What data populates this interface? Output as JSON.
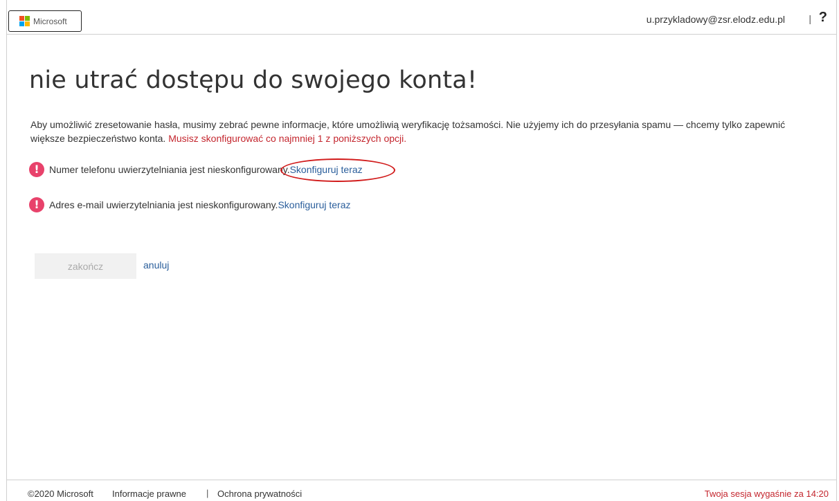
{
  "header": {
    "logo_text": "Microsoft",
    "logo_colors": [
      "#f25022",
      "#7fba00",
      "#00a4ef",
      "#ffb900"
    ],
    "user_email": "u.przykladowy@zsr.elodz.edu.pl",
    "separator": "|",
    "help_label": "?"
  },
  "main": {
    "title": "nie utrać dostępu do swojego konta!",
    "intro_text": "Aby umożliwić zresetowanie hasła, musimy zebrać pewne informacje, które umożliwią weryfikację tożsamości. Nie użyjemy ich do przesyłania spamu — chcemy tylko zapewnić większe bezpieczeństwo konta. ",
    "intro_required": "Musisz skonfigurować co najmniej 1 z poniższych opcji.",
    "items": [
      {
        "text": "Numer telefonu uwierzytelniania jest nieskonfigurowany. ",
        "link": "Skonfiguruj teraz"
      },
      {
        "text": "Adres e-mail uwierzytelniania jest nieskonfigurowany. ",
        "link": "Skonfiguruj teraz"
      }
    ],
    "warning_glyph": "!",
    "finish_label": "zakończ",
    "cancel_label": "anuluj"
  },
  "footer": {
    "copyright": "©2020 Microsoft",
    "legal": "Informacje prawne",
    "separator": "|",
    "privacy": "Ochrona prywatności",
    "session": "Twoja sesja wygaśnie za 14:20"
  },
  "colors": {
    "accent_link": "#2a5e9b",
    "error_red": "#c4262e",
    "warning_pink": "#e8426b",
    "annotation_circle": "#d11a1a"
  }
}
